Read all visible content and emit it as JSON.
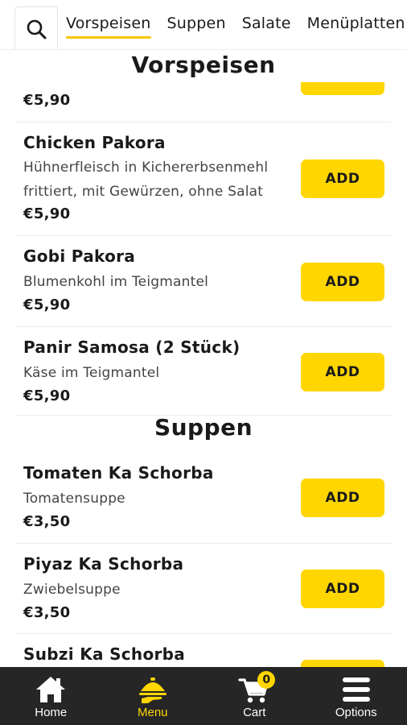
{
  "search": {
    "icon": "search-icon"
  },
  "tabs": [
    {
      "label": "Vorspeisen",
      "active": true
    },
    {
      "label": "Suppen",
      "active": false
    },
    {
      "label": "Salate",
      "active": false
    },
    {
      "label": "Menüplatten",
      "active": false
    }
  ],
  "sections": {
    "vorspeisen": {
      "title": "Vorspeisen"
    },
    "suppen": {
      "title": "Suppen"
    }
  },
  "partial_item": {
    "price": "€5,90"
  },
  "items": [
    {
      "name": "Chicken Pakora",
      "description": "Hühnerfleisch in Kichererbsenmehl frittiert, mit Gewürzen, ohne Salat",
      "price": "€5,90",
      "button": "ADD"
    },
    {
      "name": "Gobi Pakora",
      "description": "Blumenkohl im Teigmantel",
      "price": "€5,90",
      "button": "ADD"
    },
    {
      "name": "Panir Samosa (2 Stück)",
      "description": "Käse im Teigmantel",
      "price": "€5,90",
      "button": "ADD"
    },
    {
      "name": "Tomaten Ka Schorba",
      "description": "Tomatensuppe",
      "price": "€3,50",
      "button": "ADD"
    },
    {
      "name": "Piyaz Ka Schorba",
      "description": "Zwiebelsuppe",
      "price": "€3,50",
      "button": "ADD"
    },
    {
      "name": "Subzi Ka Schorba"
    }
  ],
  "bottom_nav": [
    {
      "label": "Home",
      "icon": "home-icon",
      "active": false
    },
    {
      "label": "Menu",
      "icon": "menu-dish-icon",
      "active": true
    },
    {
      "label": "Cart",
      "icon": "cart-icon",
      "active": false,
      "badge": "0"
    },
    {
      "label": "Options",
      "icon": "hamburger-icon",
      "active": false
    }
  ],
  "colors": {
    "accent": "#ffd600",
    "nav_background": "#262626",
    "text": "#1a1a1a"
  }
}
